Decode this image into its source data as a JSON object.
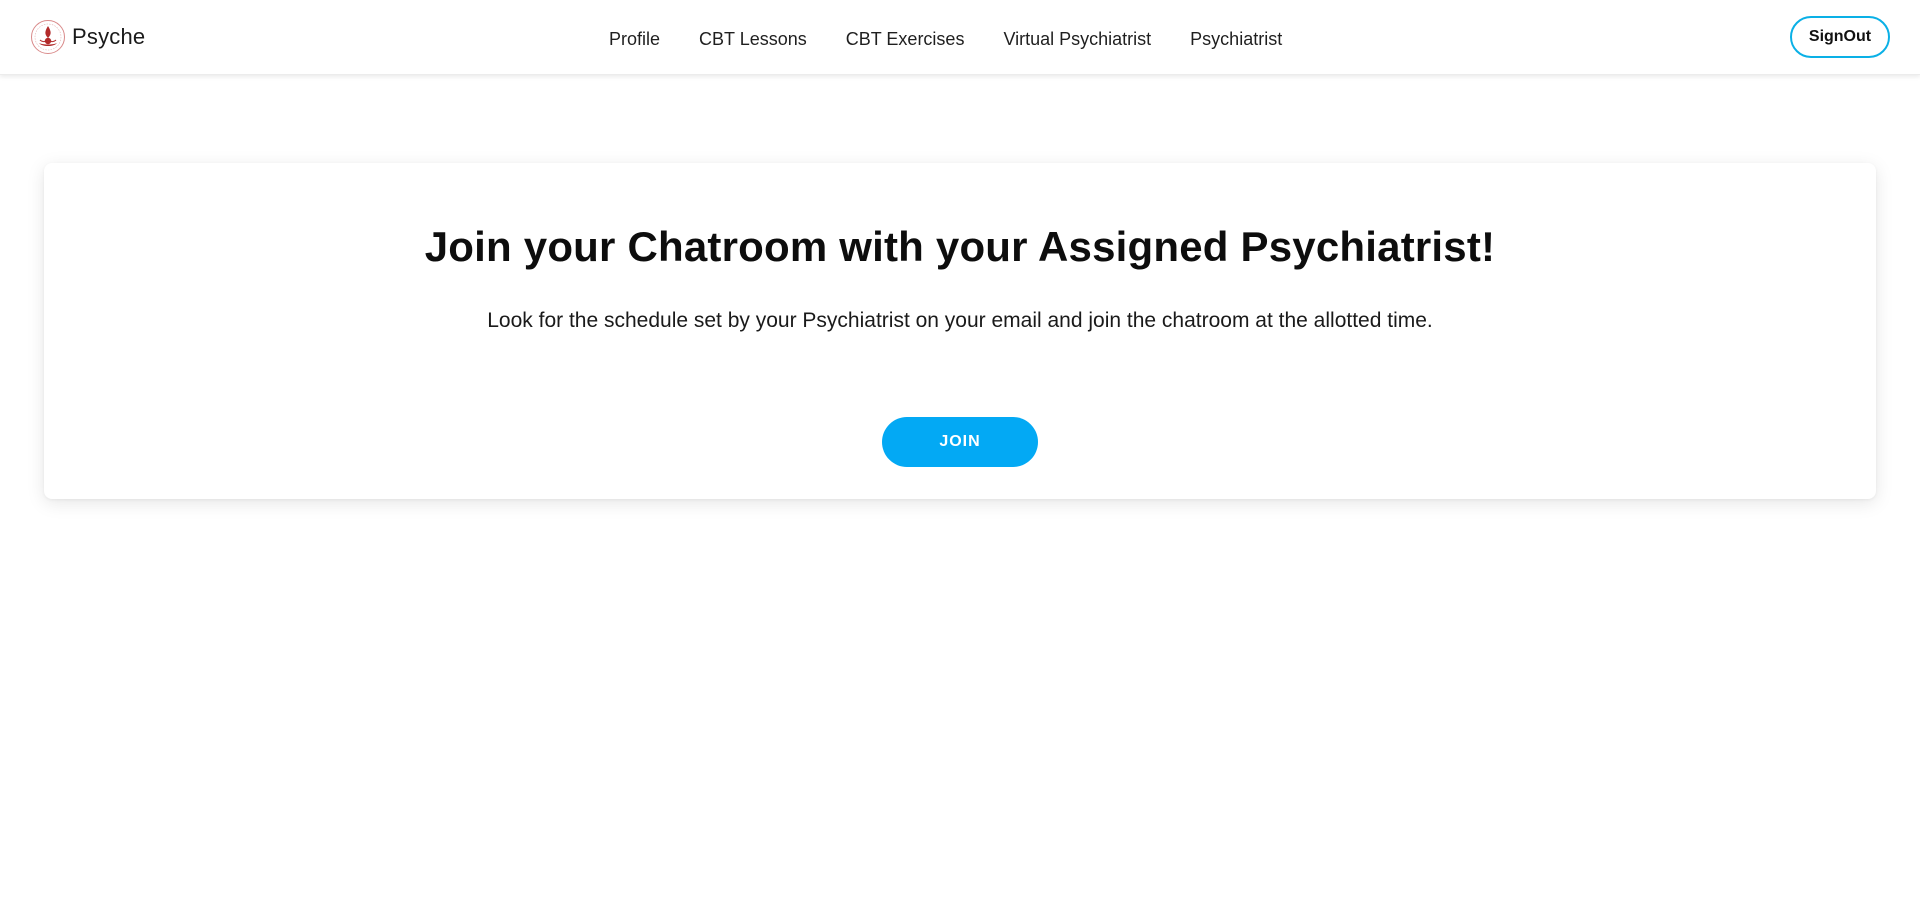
{
  "brand": {
    "name": "Psyche",
    "logo_icon": "psyche-logo-icon"
  },
  "nav": {
    "links": [
      {
        "label": "Profile"
      },
      {
        "label": "CBT Lessons"
      },
      {
        "label": "CBT Exercises"
      },
      {
        "label": "Virtual Psychiatrist"
      },
      {
        "label": "Psychiatrist"
      }
    ],
    "signout_label": "SignOut"
  },
  "main": {
    "title": "Join your Chatroom with your Assigned Psychiatrist!",
    "description": "Look for the schedule set by your Psychiatrist on your email and join the chatroom at the allotted time.",
    "join_label": "JOIN"
  },
  "colors": {
    "accent": "#03a9f4",
    "signout_border": "#0ab0e6",
    "logo_red": "#b22a2a"
  }
}
